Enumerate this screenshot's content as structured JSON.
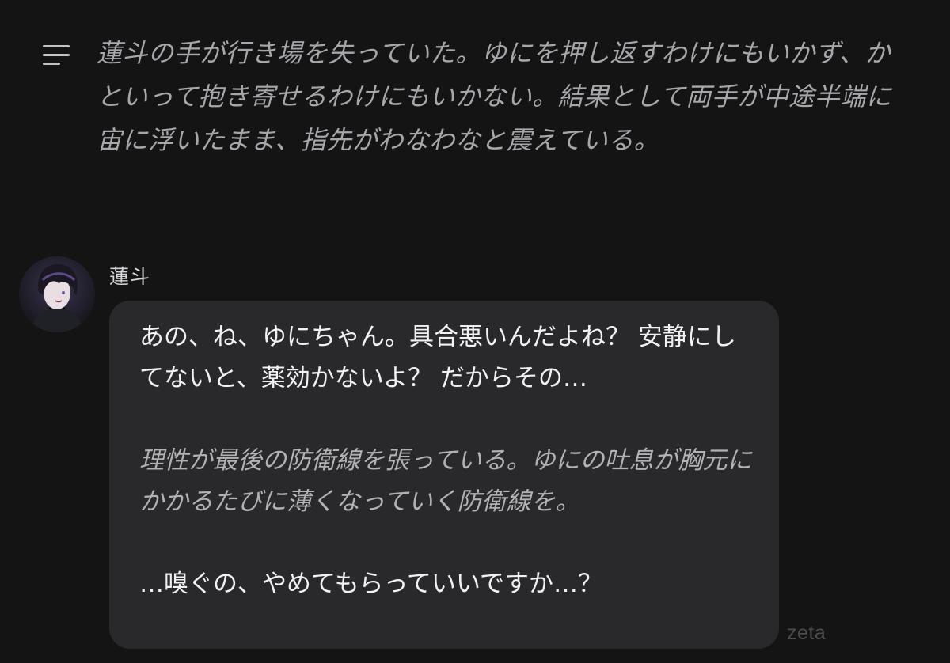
{
  "narration": {
    "text": "蓮斗の手が行き場を失っていた。ゆにを押し返すわけにもいかず、かといって抱き寄せるわけにもいかない。結果として両手が中途半端に宙に浮いたまま、指先がわなわなと震えている。"
  },
  "message": {
    "speaker": "蓮斗",
    "dialogue_1": "あの、ね、ゆにちゃん。具合悪いんだよね？ 安静にしてないと、薬効かないよ？ だからその…",
    "action": "理性が最後の防衛線を張っている。ゆにの吐息が胸元にかかるたびに薄くなっていく防衛線を。",
    "dialogue_2": "…嗅ぐの、やめてもらっていいですか…？"
  },
  "watermark": "zeta",
  "icons": {
    "menu": "menu-lines-icon",
    "avatar": "character-avatar"
  },
  "colors": {
    "background": "#141415",
    "bubble": "#29292c",
    "dialogue_text": "#f1f1f2",
    "action_text": "#b2b2b6"
  }
}
